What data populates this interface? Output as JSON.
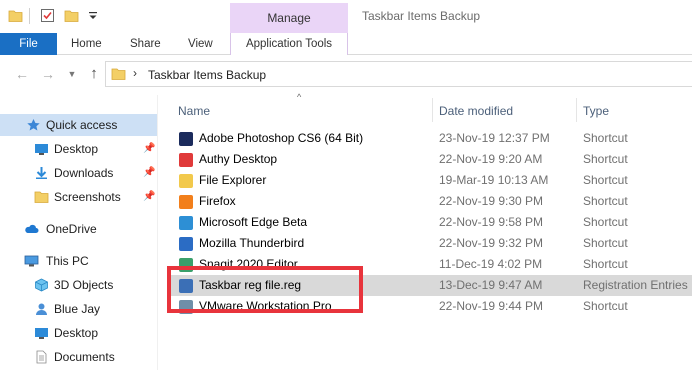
{
  "titlebar": {
    "manage_label": "Manage",
    "window_title": "Taskbar Items Backup",
    "icons": [
      "folder-icon",
      "properties-icon",
      "new-folder-icon",
      "customize-dropdown-icon"
    ]
  },
  "ribbon": {
    "tabs": [
      {
        "label": "File"
      },
      {
        "label": "Home"
      },
      {
        "label": "Share"
      },
      {
        "label": "View"
      },
      {
        "label": "Application Tools"
      }
    ],
    "file_color": "#1a6fc4",
    "manage_color": "#ead5f7"
  },
  "address": {
    "back_icon": "back-arrow-icon",
    "forward_icon": "forward-arrow-icon",
    "recent_icon": "chevron-down-icon",
    "up_icon": "up-arrow-icon",
    "path": "Taskbar Items Backup"
  },
  "sidebar": {
    "items": [
      {
        "label": "Quick access",
        "icon": "star-icon"
      },
      {
        "label": "Desktop",
        "icon": "desktop-icon",
        "pinned": true
      },
      {
        "label": "Downloads",
        "icon": "download-icon",
        "pinned": true
      },
      {
        "label": "Screenshots",
        "icon": "folder-icon",
        "pinned": true
      },
      {
        "label": "OneDrive",
        "icon": "cloud-icon"
      },
      {
        "label": "This PC",
        "icon": "computer-icon"
      },
      {
        "label": "3D Objects",
        "icon": "cube-icon"
      },
      {
        "label": "Blue Jay",
        "icon": "user-icon"
      },
      {
        "label": "Desktop",
        "icon": "desktop-icon"
      },
      {
        "label": "Documents",
        "icon": "document-icon"
      }
    ],
    "selected_color": "#cde0f5"
  },
  "columns": {
    "name": "Name",
    "date_modified": "Date modified",
    "type": "Type"
  },
  "files": [
    {
      "name": "Adobe Photoshop CS6 (64 Bit)",
      "date": "23-Nov-19 12:37 PM",
      "type": "Shortcut",
      "color": "#1b2b5c"
    },
    {
      "name": "Authy Desktop",
      "date": "22-Nov-19 9:20 AM",
      "type": "Shortcut",
      "color": "#e03a3a"
    },
    {
      "name": "File Explorer",
      "date": "19-Mar-19 10:13 AM",
      "type": "Shortcut",
      "color": "#f2c94c"
    },
    {
      "name": "Firefox",
      "date": "22-Nov-19 9:30 PM",
      "type": "Shortcut",
      "color": "#f27f1b"
    },
    {
      "name": "Microsoft Edge Beta",
      "date": "22-Nov-19 9:58 PM",
      "type": "Shortcut",
      "color": "#2d8fd5"
    },
    {
      "name": "Mozilla Thunderbird",
      "date": "22-Nov-19 9:32 PM",
      "type": "Shortcut",
      "color": "#2b6cc4"
    },
    {
      "name": "Snagit 2020 Editor",
      "date": "11-Dec-19 4:02 PM",
      "type": "Shortcut",
      "color": "#3aa06b"
    },
    {
      "name": "Taskbar reg file.reg",
      "date": "13-Dec-19 9:47 AM",
      "type": "Registration Entries",
      "color": "#3b6fb6"
    },
    {
      "name": "VMware Workstation Pro",
      "date": "22-Nov-19 9:44 PM",
      "type": "Shortcut",
      "color": "#6f8fa8"
    }
  ],
  "selected_file_index": 7,
  "highlight_color": "#e8343c"
}
